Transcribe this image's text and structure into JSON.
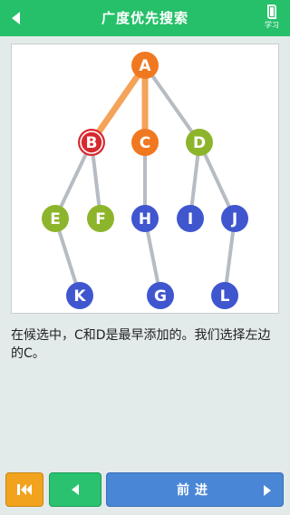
{
  "header": {
    "title": "广度优先搜索",
    "learn_label": "学习"
  },
  "graph": {
    "colors": {
      "orange": "#f07820",
      "red": "#d7282f",
      "green": "#8db52b",
      "blue": "#3f56cf",
      "edge": "#b6bcc2",
      "highlight": "#f4a35a"
    },
    "nodes": [
      {
        "id": "A",
        "color": "orange"
      },
      {
        "id": "B",
        "color": "red",
        "ring": true
      },
      {
        "id": "C",
        "color": "orange"
      },
      {
        "id": "D",
        "color": "green"
      },
      {
        "id": "E",
        "color": "green"
      },
      {
        "id": "F",
        "color": "green"
      },
      {
        "id": "H",
        "color": "blue"
      },
      {
        "id": "I",
        "color": "blue"
      },
      {
        "id": "J",
        "color": "blue"
      },
      {
        "id": "K",
        "color": "blue"
      },
      {
        "id": "G",
        "color": "blue"
      },
      {
        "id": "L",
        "color": "blue"
      }
    ],
    "edges": [
      {
        "from": "A",
        "to": "B",
        "highlight": true
      },
      {
        "from": "A",
        "to": "C",
        "highlight": true
      },
      {
        "from": "A",
        "to": "D",
        "highlight": false
      },
      {
        "from": "B",
        "to": "E",
        "highlight": false
      },
      {
        "from": "B",
        "to": "F",
        "highlight": false
      },
      {
        "from": "C",
        "to": "H",
        "highlight": false
      },
      {
        "from": "D",
        "to": "I",
        "highlight": false
      },
      {
        "from": "D",
        "to": "J",
        "highlight": false
      },
      {
        "from": "E",
        "to": "K",
        "highlight": false
      },
      {
        "from": "H",
        "to": "G",
        "highlight": false
      },
      {
        "from": "J",
        "to": "L",
        "highlight": false
      }
    ]
  },
  "description": "在候选中，C和D是最早添加的。我们选择左边的C。",
  "controls": {
    "next_label": "前进"
  },
  "icons": {
    "back": "back-arrow-icon",
    "learn": "book-icon",
    "restart": "skip-to-start-icon",
    "prev": "triangle-left-icon",
    "next": "triangle-right-icon"
  }
}
